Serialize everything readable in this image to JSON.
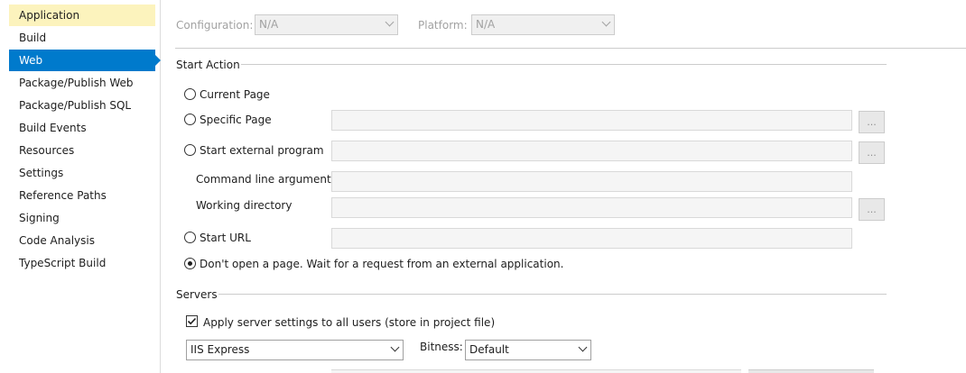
{
  "sidebar": {
    "items": [
      {
        "label": "Application",
        "state": "hover"
      },
      {
        "label": "Build",
        "state": ""
      },
      {
        "label": "Web",
        "state": "active"
      },
      {
        "label": "Package/Publish Web",
        "state": ""
      },
      {
        "label": "Package/Publish SQL",
        "state": ""
      },
      {
        "label": "Build Events",
        "state": ""
      },
      {
        "label": "Resources",
        "state": ""
      },
      {
        "label": "Settings",
        "state": ""
      },
      {
        "label": "Reference Paths",
        "state": ""
      },
      {
        "label": "Signing",
        "state": ""
      },
      {
        "label": "Code Analysis",
        "state": ""
      },
      {
        "label": "TypeScript Build",
        "state": ""
      }
    ]
  },
  "top": {
    "configuration_label": "Configuration:",
    "configuration_value": "N/A",
    "platform_label": "Platform:",
    "platform_value": "N/A"
  },
  "start_action": {
    "title": "Start Action",
    "current_page": "Current Page",
    "specific_page": "Specific Page",
    "start_external_program": "Start external program",
    "command_line_arguments": "Command line arguments",
    "working_directory": "Working directory",
    "start_url": "Start URL",
    "dont_open": "Don't open a page.  Wait for a request from an external application.",
    "browse_label": "..."
  },
  "servers": {
    "title": "Servers",
    "apply_settings": "Apply server settings to all users (store in project file)",
    "apply_checked": true,
    "server_value": "IIS Express",
    "bitness_label": "Bitness:",
    "bitness_value": "Default"
  },
  "colors": {
    "accent": "#007acc",
    "hover": "#fcf3bd"
  }
}
